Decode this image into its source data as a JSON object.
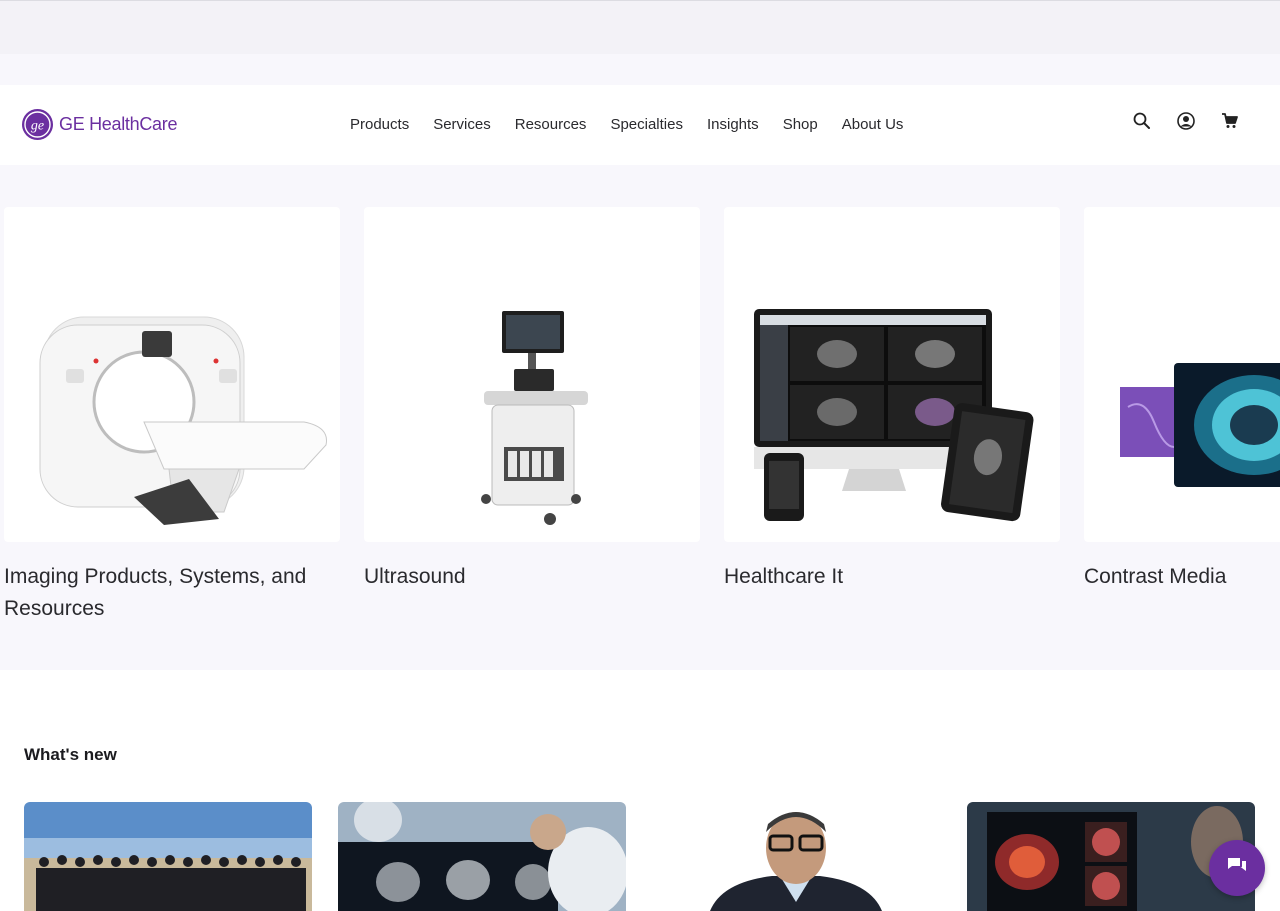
{
  "brand": {
    "name": "GE HealthCare",
    "color": "#6b2fa0"
  },
  "nav": {
    "items": [
      "Products",
      "Services",
      "Resources",
      "Specialties",
      "Insights",
      "Shop",
      "About Us"
    ]
  },
  "header_icons": [
    "search-icon",
    "account-icon",
    "cart-icon"
  ],
  "categories": [
    {
      "title": "Imaging Products, Systems, and Resources",
      "image": "ct-scanner-image"
    },
    {
      "title": "Ultrasound",
      "image": "ultrasound-machine-image"
    },
    {
      "title": "Healthcare It",
      "image": "healthcare-it-devices-image"
    },
    {
      "title": "Contrast Media",
      "image": "contrast-media-scans-image"
    }
  ],
  "whats_new": {
    "title": "What's new",
    "items": [
      "group-photo-image",
      "brain-scan-review-image",
      "executive-portrait-image",
      "mri-review-image"
    ]
  },
  "chat": {
    "icon": "chat-icon"
  }
}
